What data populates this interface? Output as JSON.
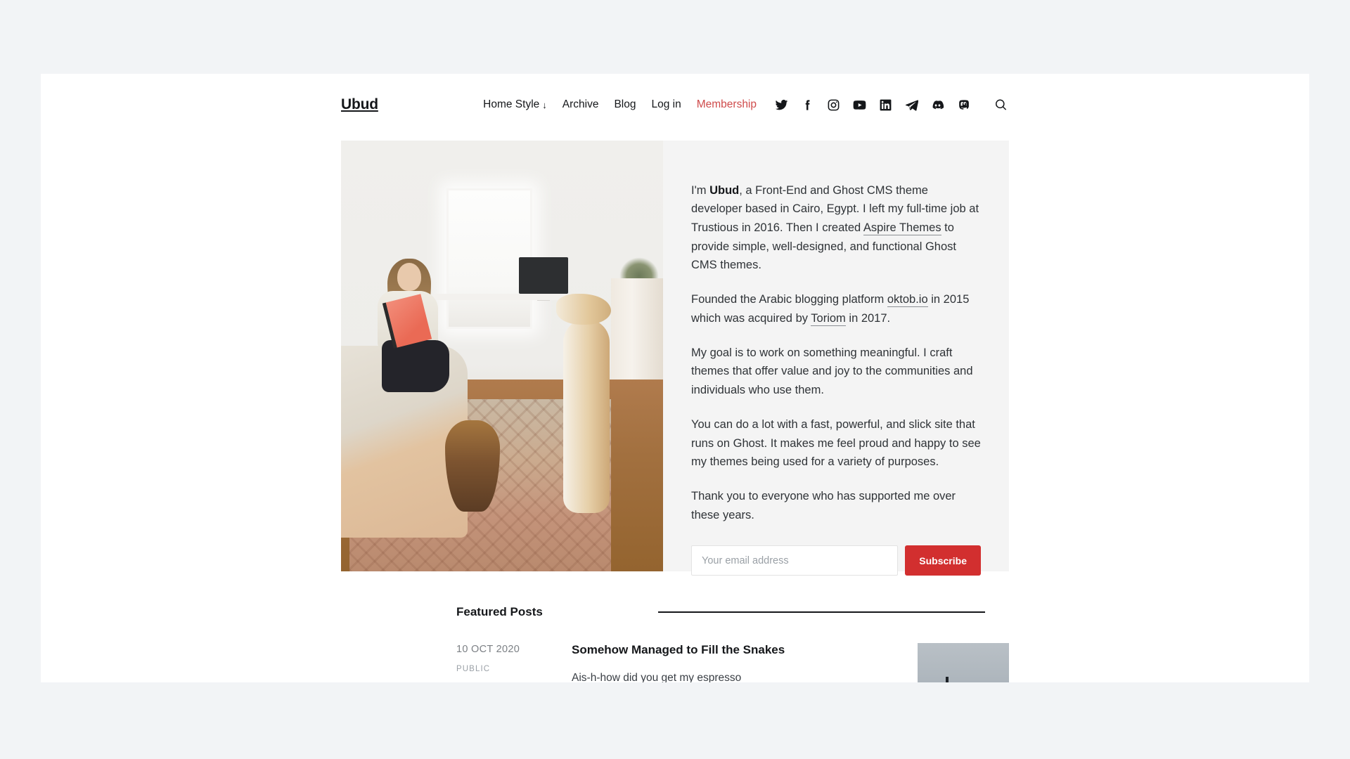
{
  "site": {
    "brand": "Ubud"
  },
  "nav": {
    "items": [
      {
        "label": "Home Style",
        "has_dropdown": true,
        "arrow": "↓",
        "accent": false
      },
      {
        "label": "Archive",
        "has_dropdown": false,
        "accent": false
      },
      {
        "label": "Blog",
        "has_dropdown": false,
        "accent": false
      },
      {
        "label": "Log in",
        "has_dropdown": false,
        "accent": false
      },
      {
        "label": "Membership",
        "has_dropdown": false,
        "accent": true
      }
    ],
    "accent_color": "#cf4b4b"
  },
  "social": {
    "icons": [
      "twitter-icon",
      "facebook-icon",
      "instagram-icon",
      "youtube-icon",
      "linkedin-icon",
      "telegram-icon",
      "discord-icon",
      "mastodon-icon"
    ],
    "search": "search-icon"
  },
  "hero": {
    "image_alt": "Woman sitting on bed holding a book with two dogs on a patterned rug in a bright bedroom",
    "bio": {
      "p1_pre": "I'm ",
      "p1_bold": "Ubud",
      "p1_mid": ", a Front-End and Ghost CMS theme developer based in Cairo, Egypt. I left my full-time job at Trustious in 2016. Then I created ",
      "p1_link": "Aspire Themes",
      "p1_post": " to provide simple, well-designed, and functional Ghost CMS themes.",
      "p2_pre": "Founded the Arabic blogging platform ",
      "p2_link1": "oktob.io",
      "p2_mid": " in 2015 which was acquired by ",
      "p2_link2": "Toriom",
      "p2_post": " in 2017.",
      "p3": "My goal is to work on something meaningful. I craft themes that offer value and joy to the communities and individuals who use them.",
      "p4": "You can do a lot with a fast, powerful, and slick site that runs on Ghost. It makes me feel proud and happy to see my themes being used for a variety of purposes.",
      "p5": "Thank you to everyone who has supported me over these years."
    },
    "subscribe": {
      "placeholder": "Your email address",
      "value": "",
      "button_label": "Subscribe",
      "button_color": "#d22f2f"
    }
  },
  "featured": {
    "title": "Featured Posts",
    "posts": [
      {
        "date": "10 OCT 2020",
        "access": "PUBLIC",
        "title": "Somehow Managed to Fill the Snakes",
        "excerpt": "Ais-h-how did you get my espresso machine? You know what? It is beets. I've",
        "thumb_alt": "Grey seascape with a dark pier"
      }
    ]
  }
}
